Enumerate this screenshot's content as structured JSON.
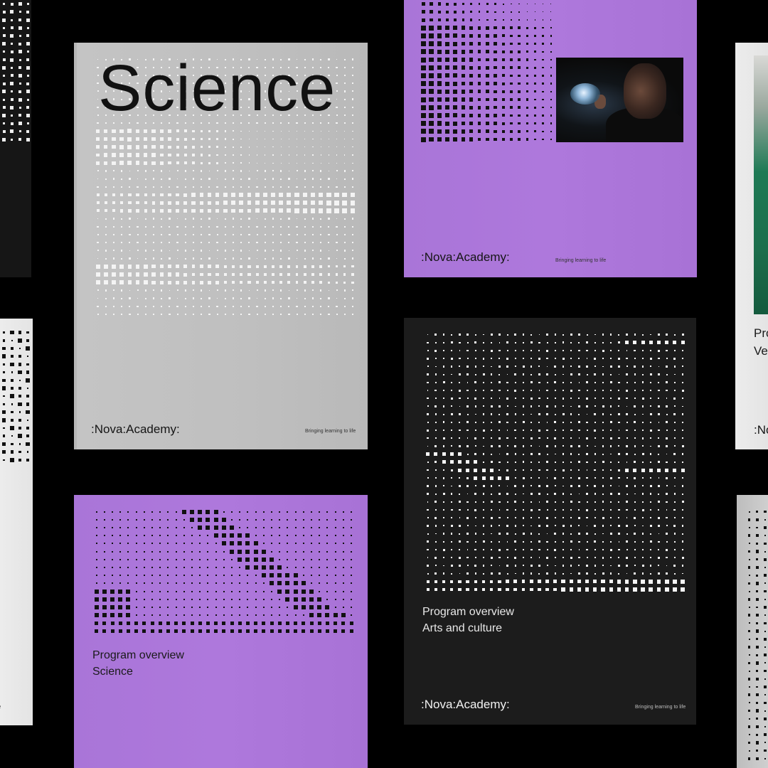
{
  "brand": {
    "logo": ":Nova:Academy:",
    "tagline": "Bringing learning to life"
  },
  "covers": {
    "science_gray": {
      "title": "Science"
    },
    "purple_science": {
      "line1": "Program overview",
      "line2": "Science"
    },
    "dark_arts": {
      "line1": "Program overview",
      "line2": "Arts and culture"
    },
    "right_partial": {
      "line1": "Pro",
      "line2": "Ve",
      "logo_fragment": ":No"
    }
  },
  "colors": {
    "background": "#000000",
    "purple": "#ad77db",
    "gray": "#c0c0c0",
    "dark": "#1c1c1c",
    "light": "#e8e8e8"
  }
}
